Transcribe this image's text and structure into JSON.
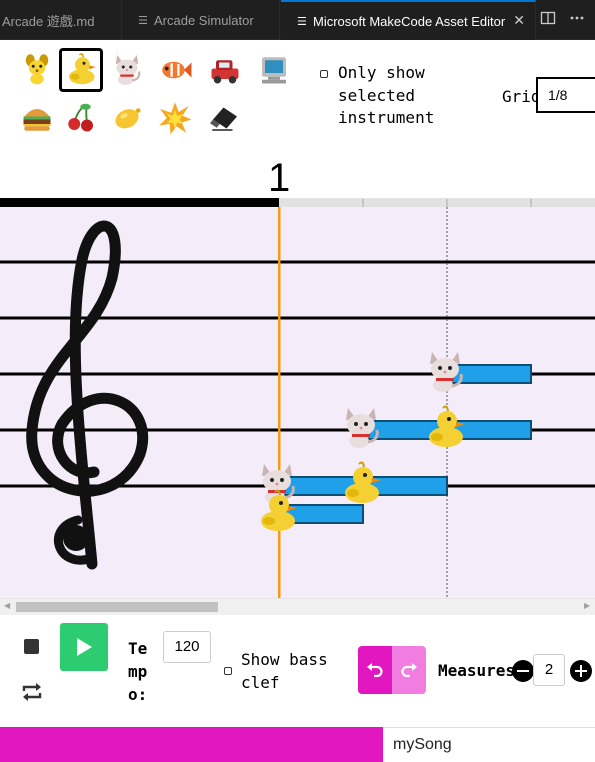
{
  "tabs": [
    {
      "label": "Arcade 遊戲.md",
      "icon": "markdown-file-icon",
      "active": false
    },
    {
      "label": "Arcade Simulator",
      "icon": "preview-icon",
      "active": false
    },
    {
      "label": "Microsoft MakeCode Asset Editor",
      "icon": "preview-icon",
      "active": true,
      "close": "✕"
    }
  ],
  "tab_actions": [
    "split-editor-icon",
    "more-actions-icon"
  ],
  "instruments": [
    {
      "name": "dog",
      "selected": false
    },
    {
      "name": "duck",
      "selected": true
    },
    {
      "name": "cat",
      "selected": false
    },
    {
      "name": "fish",
      "selected": false
    },
    {
      "name": "car",
      "selected": false
    },
    {
      "name": "computer",
      "selected": false
    },
    {
      "name": "burger",
      "selected": false
    },
    {
      "name": "cherry",
      "selected": false
    },
    {
      "name": "lemon",
      "selected": false
    },
    {
      "name": "explosion",
      "selected": false
    },
    {
      "name": "eraser",
      "selected": false
    }
  ],
  "only_show": {
    "lines": [
      "Only show",
      "selected",
      "instrument"
    ],
    "checked": false
  },
  "grid": {
    "label": "Grid",
    "value": "1/8"
  },
  "measure_number": "1",
  "staff": {
    "clef": "treble-clef-icon",
    "bg_color": "#f5ecf9",
    "playhead_color": "#f39c12",
    "note_bar_color": "#1fa0e8"
  },
  "notes": [
    {
      "instrument": "cat",
      "step": 0,
      "length": 1,
      "line": 5
    },
    {
      "instrument": "duck",
      "step": 0,
      "length": 1,
      "line": 5.5
    },
    {
      "instrument": "cat",
      "step": 1,
      "length": 1,
      "line": 4
    },
    {
      "instrument": "duck",
      "step": 1,
      "length": 1,
      "line": 5
    },
    {
      "instrument": "cat",
      "step": 2,
      "length": 1,
      "line": 3
    },
    {
      "instrument": "duck",
      "step": 2,
      "length": 1,
      "line": 4
    }
  ],
  "controls": {
    "tempo_label": "Tempo:",
    "tempo_value": "120",
    "bass_clef": {
      "lines": [
        "Show bass",
        "clef"
      ],
      "checked": false
    },
    "measures_label": "Measures",
    "measures_value": "2",
    "accent_color": "#e116c1",
    "play_color": "#2ecc71"
  },
  "asset_name": "mySong"
}
